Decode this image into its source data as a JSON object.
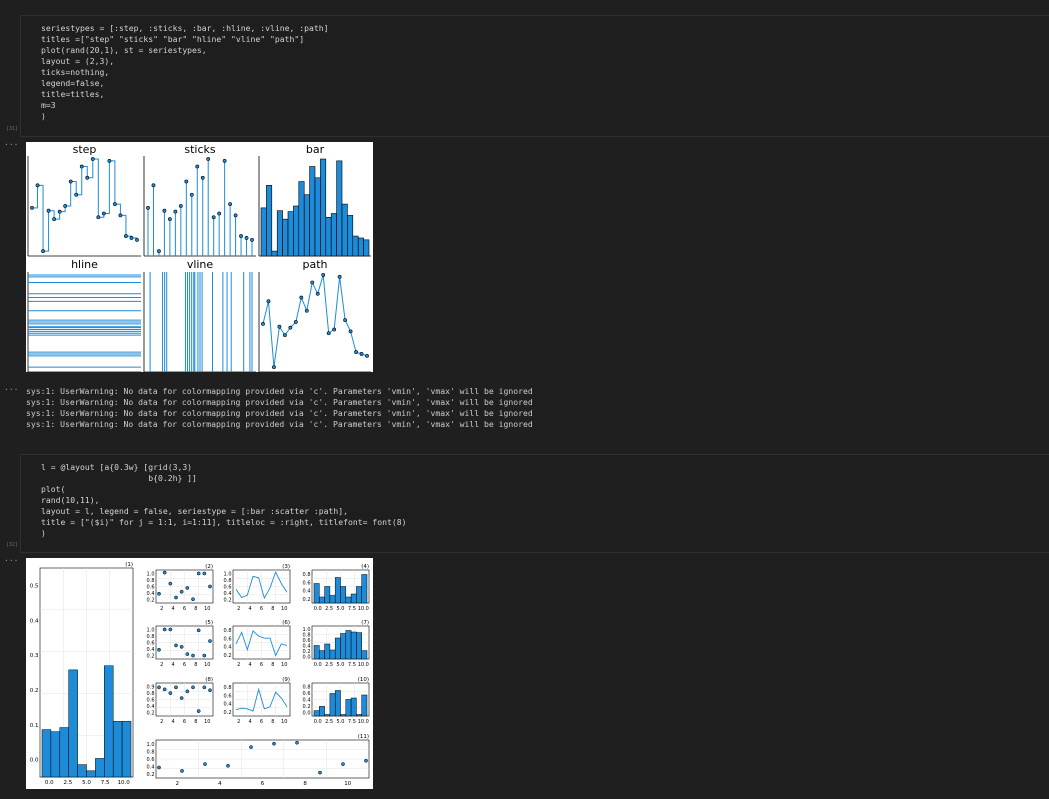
{
  "cell31": {
    "exec_count": "[31]",
    "lines": [
      "seriestypes = [:step, :sticks, :bar, :hline, :vline, :path]",
      "titles =[\"step\" \"sticks\" \"bar\" \"hline\" \"vline\" \"path\"]",
      "plot(rand(20,1), st = seriestypes,",
      "layout = (2,3),",
      "ticks=nothing,",
      "legend=false,",
      "title=titles,",
      "m=3",
      ")"
    ],
    "output_dots": "···"
  },
  "plot1": {
    "titles": [
      "step",
      "sticks",
      "bar",
      "hline",
      "vline",
      "path"
    ],
    "accent": "#1e8bd8",
    "data": [
      0.48,
      0.72,
      0.02,
      0.45,
      0.36,
      0.44,
      0.5,
      0.76,
      0.62,
      0.92,
      0.8,
      1.0,
      0.38,
      0.42,
      0.98,
      0.52,
      0.4,
      0.18,
      0.16,
      0.14
    ]
  },
  "warnings": {
    "output_dots": "···",
    "lines": [
      "sys:1: UserWarning: No data for colormapping provided via 'c'. Parameters 'vmin', 'vmax' will be ignored",
      "sys:1: UserWarning: No data for colormapping provided via 'c'. Parameters 'vmin', 'vmax' will be ignored",
      "sys:1: UserWarning: No data for colormapping provided via 'c'. Parameters 'vmin', 'vmax' will be ignored",
      "sys:1: UserWarning: No data for colormapping provided via 'c'. Parameters 'vmin', 'vmax' will be ignored"
    ]
  },
  "cell32": {
    "exec_count": "[32]",
    "lines": [
      "l = @layout [a{0.3w} [grid(3,3)",
      "                      b{0.2h} ]]",
      "plot(",
      "rand(10,11),",
      "layout = l, legend = false, seriestype = [:bar :scatter :path],",
      "title = [\"($i)\" for j = 1:1, i=1:11], titleloc = :right, titlefont= font(8)",
      ")"
    ],
    "output_dots": "···"
  },
  "plot2": {
    "titles": [
      "(1)",
      "(2)",
      "(3)",
      "(4)",
      "(5)",
      "(6)",
      "(7)",
      "(8)",
      "(9)",
      "(10)",
      "(11)"
    ],
    "series1": [
      0.23,
      0.22,
      0.24,
      0.52,
      0.06,
      0.03,
      0.09,
      0.54,
      0.27,
      0.27
    ],
    "series2": [
      0.25,
      0.98,
      0.6,
      0.12,
      0.32,
      0.45,
      0.06,
      0.95,
      0.95,
      0.5
    ],
    "series3": [
      0.4,
      0.12,
      0.2,
      0.85,
      0.8,
      0.1,
      0.45,
      1.0,
      0.6,
      0.3
    ],
    "series4": [
      0.65,
      0.2,
      0.55,
      0.25,
      0.85,
      0.55,
      0.2,
      0.3,
      0.55,
      0.95
    ],
    "series5": [
      0.25,
      0.95,
      0.95,
      0.4,
      0.35,
      0.1,
      0.05,
      0.92,
      0.05,
      0.55
    ],
    "series6": [
      0.45,
      0.85,
      0.25,
      0.9,
      0.72,
      0.65,
      0.65,
      0.05,
      0.45,
      0.4
    ],
    "series7": [
      0.45,
      0.28,
      0.5,
      0.3,
      0.7,
      0.85,
      0.95,
      0.9,
      0.88,
      0.28
    ],
    "series8": [
      0.92,
      0.85,
      0.72,
      0.92,
      0.55,
      0.78,
      0.92,
      0.1,
      0.92,
      0.82
    ],
    "series9": [
      0.15,
      0.2,
      0.18,
      0.1,
      0.85,
      0.18,
      0.25,
      0.75,
      0.55,
      0.25
    ],
    "series10": [
      0.18,
      0.32,
      0.05,
      0.75,
      0.85,
      0.05,
      0.55,
      0.6,
      0.05,
      0.7
    ],
    "series11": [
      0.25,
      0.15,
      0.35,
      0.3,
      0.85,
      0.95,
      0.98,
      0.1,
      0.35,
      0.45
    ],
    "ticks_bar_x": [
      "0.0",
      "2.5",
      "5.0",
      "7.5",
      "10.0"
    ],
    "ticks_main_y": [
      "0.0",
      "0.1",
      "0.2",
      "0.3",
      "0.4",
      "0.5"
    ],
    "ticks_small_x": [
      "2",
      "4",
      "6",
      "8",
      "10"
    ],
    "ticks_wide_x": [
      "2",
      "4",
      "6",
      "8",
      "10"
    ],
    "ticks_small_y_a": [
      "0.2",
      "0.4",
      "0.6",
      "0.8",
      "1.0"
    ],
    "ticks_small_y_b": [
      "0.2",
      "0.4",
      "0.6",
      "0.8"
    ],
    "ticks_small_y_c": [
      "0.2",
      "0.4",
      "0.6",
      "0.8",
      "1.0"
    ],
    "ticks_small_y_d": [
      "0.0",
      "0.2",
      "0.4",
      "0.6",
      "0.8"
    ],
    "ticks_small_y_e": [
      "0.0",
      "0.2",
      "0.4",
      "0.6",
      "0.8",
      "1.0"
    ],
    "ticks_small_y_f": [
      "0.2",
      "0.4",
      "0.6",
      "0.8",
      "0.9"
    ],
    "ticks_small_y_g": [
      "0.2",
      "0.4",
      "0.6",
      "0.8",
      "1.0"
    ]
  }
}
